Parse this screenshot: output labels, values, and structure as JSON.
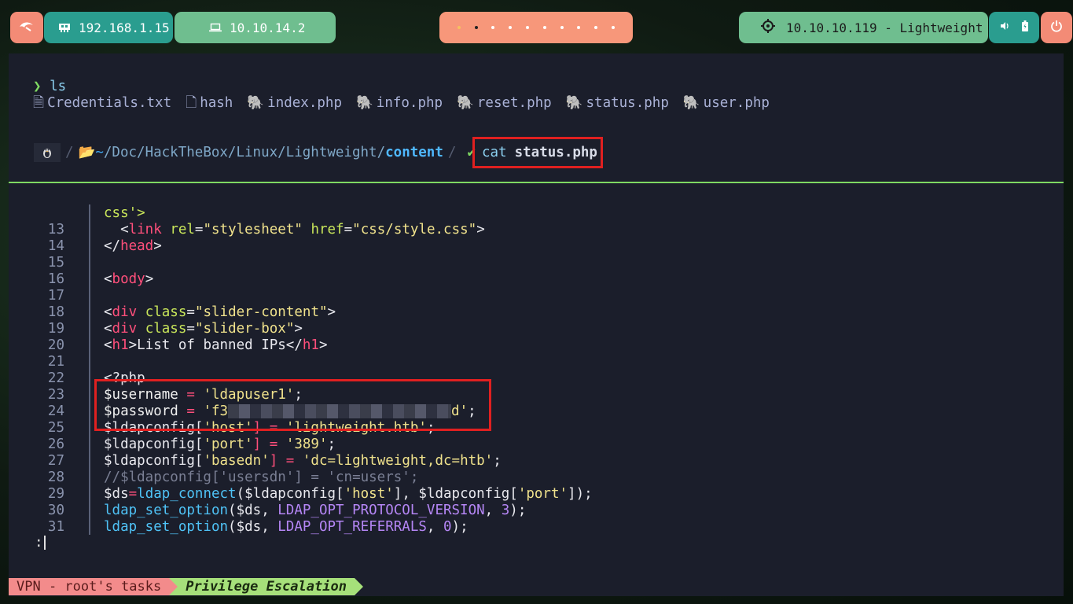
{
  "topbar": {
    "logo_icon": "debian-swirl-icon",
    "ip_local": "192.168.1.15",
    "ip_vpn": "10.10.14.2",
    "workspaces": [
      1,
      2,
      3,
      4,
      5,
      6,
      7,
      8,
      9,
      10
    ],
    "target": "10.10.10.119 - Lightweight"
  },
  "terminal": {
    "prompt_symbol": "❯",
    "ls_command": "ls",
    "files": [
      "Credentials.txt",
      "hash",
      "index.php",
      "info.php",
      "reset.php",
      "status.php",
      "user.php"
    ],
    "path_home": "~",
    "path_dirs": "/Doc/HackTheBox/Linux/Lightweight/",
    "path_current": "content",
    "cmd_name": "cat",
    "cmd_arg": "status.php",
    "first_fragment": "css'>",
    "code_lines": [
      {
        "n": "13"
      },
      {
        "n": "14"
      },
      {
        "n": "15"
      },
      {
        "n": "16"
      },
      {
        "n": "17"
      },
      {
        "n": "18"
      },
      {
        "n": "19"
      },
      {
        "n": "20"
      },
      {
        "n": "21"
      },
      {
        "n": "22"
      },
      {
        "n": "23"
      },
      {
        "n": "24"
      },
      {
        "n": "25"
      },
      {
        "n": "26"
      },
      {
        "n": "27"
      },
      {
        "n": "28"
      },
      {
        "n": "29"
      },
      {
        "n": "30"
      },
      {
        "n": "31"
      }
    ],
    "pager_prompt": ":"
  },
  "code": {
    "l13": [
      "  <",
      "link",
      " ",
      "rel",
      "=",
      "\"stylesheet\"",
      " ",
      "href",
      "=",
      "\"css/style.css\"",
      ">"
    ],
    "l14": [
      "</",
      "head",
      ">"
    ],
    "l16": [
      "<",
      "body",
      ">"
    ],
    "l18": [
      "<",
      "div",
      " ",
      "class",
      "=",
      "\"slider-content\"",
      ">"
    ],
    "l19": [
      "<",
      "div",
      " ",
      "class",
      "=",
      "\"slider-box\"",
      ">"
    ],
    "l20": [
      "<",
      "h1",
      ">List of banned IPs</",
      "h1",
      ">"
    ],
    "l22": "<?php",
    "l23": [
      "$username",
      " = ",
      "'ldapuser1'",
      ";"
    ],
    "l24": [
      "$password",
      " = ",
      "'f3",
      "d'",
      ";"
    ],
    "l25": [
      "$ldapconfig[",
      "'host'",
      "] = ",
      "'lightweight.htb'",
      ";"
    ],
    "l26": [
      "$ldapconfig[",
      "'port'",
      "] = ",
      "'389'",
      ";"
    ],
    "l27": [
      "$ldapconfig[",
      "'basedn'",
      "] = ",
      "'dc=lightweight,dc=htb'",
      ";"
    ],
    "l28": "//$ldapconfig['usersdn'] = 'cn=users';",
    "l29": [
      "$ds",
      "=",
      "ldap_connect",
      "($ldapconfig[",
      "'host'",
      "], $ldapconfig[",
      "'port'",
      "]);"
    ],
    "l30": [
      "ldap_set_option",
      "($ds, ",
      "LDAP_OPT_PROTOCOL_VERSION",
      ", ",
      "3",
      ");"
    ],
    "l31": [
      "ldap_set_option",
      "($ds, ",
      "LDAP_OPT_REFERRALS",
      ", ",
      "0",
      ");"
    ]
  },
  "statusbar": {
    "session": "VPN - root's tasks",
    "window": "Privilege Escalation"
  }
}
